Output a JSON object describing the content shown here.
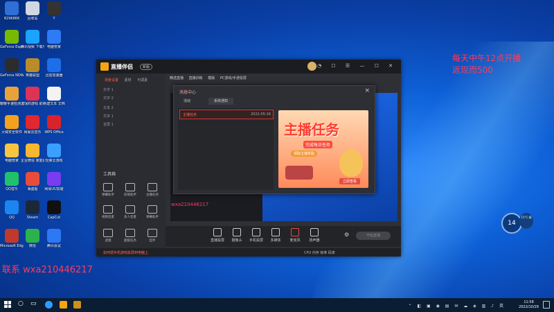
{
  "desktop": {
    "icons_col1": [
      {
        "label": "8296866",
        "name": "qq-mail-icon",
        "color": "#2f6fd6"
      },
      {
        "label": "GeForce Experience",
        "name": "geforce-icon",
        "color": "#76b900"
      },
      {
        "label": "GeForce NOW",
        "name": "geforce-now-icon",
        "color": "#2c2c2c"
      },
      {
        "label": "暖暖手速检测 直播伴侣",
        "name": "cat-app-icon",
        "color": "#e9a23b"
      },
      {
        "label": "火绒安全软件",
        "name": "huorong-icon",
        "color": "#f4a21d"
      },
      {
        "label": "电脑管家",
        "name": "folder-icon",
        "color": "#f5c542"
      },
      {
        "label": "QQ音乐",
        "name": "qqmusic-icon",
        "color": "#21c16b"
      },
      {
        "label": "QQ",
        "name": "qq-icon",
        "color": "#1b86f0"
      },
      {
        "label": "Microsoft Edge",
        "name": "game-app-icon",
        "color": "#c0392b"
      }
    ],
    "icons_col2": [
      {
        "label": "回收站",
        "name": "recycle-bin-icon",
        "color": "#cfd8e3"
      },
      {
        "label": "腾讯视频 下载中心",
        "name": "tencent-icon",
        "color": "#1aa3ff"
      },
      {
        "label": "英雄联盟",
        "name": "lol-icon",
        "color": "#b88c2a"
      },
      {
        "label": "流氓的游戏 助手",
        "name": "game-helper-icon",
        "color": "#d35"
      },
      {
        "label": "网易云音乐",
        "name": "netease-music-icon",
        "color": "#e0282e"
      },
      {
        "label": "企业微信 家庭版",
        "name": "wechat-work-icon",
        "color": "#f7b731"
      },
      {
        "label": "海盗船",
        "name": "pirate-icon",
        "color": "#e74c3c"
      },
      {
        "label": "Steam",
        "name": "steam-icon",
        "color": "#1b2838"
      },
      {
        "label": "微信",
        "name": "wechat-icon",
        "color": "#2bb24c"
      }
    ],
    "icons_col3": [
      {
        "label": "Y",
        "name": "y-app-icon",
        "color": "#333"
      },
      {
        "label": "电脑管家",
        "name": "shield-app-icon",
        "color": "#2e7bf6"
      },
      {
        "label": "迅雷加速器",
        "name": "accelerator-icon",
        "color": "#1c6fe8"
      },
      {
        "label": "新建文本 文档",
        "name": "text-doc-icon",
        "color": "#f3f3f3"
      },
      {
        "label": "WPS Office",
        "name": "wps-icon",
        "color": "#d9232b"
      },
      {
        "label": "轻量云游戏",
        "name": "cloud-game-icon",
        "color": "#39a0ff"
      },
      {
        "label": "网易UU加速",
        "name": "uu-icon",
        "color": "#7a3cf0"
      },
      {
        "label": "CapCut",
        "name": "capcut-icon",
        "color": "#111"
      },
      {
        "label": "腾讯会议",
        "name": "meeting-icon",
        "color": "#2d78f5"
      }
    ]
  },
  "app": {
    "title": "直播伴侣",
    "badge": "新版",
    "top_tabs": [
      "精选直播",
      "直播训练",
      "模版",
      "PC游戏/手游投屏"
    ],
    "sidebar_tabs": [
      "场景设置",
      "素材",
      "可调素"
    ],
    "scenes": [
      "文字 1",
      "文字 2",
      "文本 2",
      "文本 1",
      "全屏 1"
    ],
    "tools_title": "工具箱",
    "tools": [
      "弹幕助手",
      "房管助手",
      "主播任务",
      "视频连麦",
      "多人连麦",
      "弹幕助手",
      "滤镜",
      "超级任务",
      "挂件"
    ],
    "bottom_buttons": [
      "直播投屏",
      "摄像头",
      "手机投屏",
      "多媒体",
      "麦克风",
      "扬声器"
    ],
    "start_button": "开始直播",
    "status_text": "如何把手机游戏投屏到电脑上",
    "status_right": "CPU 内存 帧率 码率"
  },
  "dialog": {
    "title": "消息中心",
    "tabs": [
      "活动",
      "系统通知"
    ],
    "active_tab": 1,
    "list_item": {
      "title": "主播任务",
      "date": "2022-05-16"
    },
    "promo": {
      "title": "主播任务",
      "subtitle": "完成每日任务",
      "cta": "领取主播奖励",
      "button": "立即查看"
    },
    "close": "×"
  },
  "annotations": {
    "line1": "每天中午12点开播",
    "line2": "返现而500",
    "watermark": "联系 wxa210446217",
    "watermark_small": "wxa210446217"
  },
  "weather": {
    "temp": "14",
    "detail": "15°C 晴"
  },
  "taskbar": {
    "time": "11:58",
    "date": "2022/10/29"
  }
}
